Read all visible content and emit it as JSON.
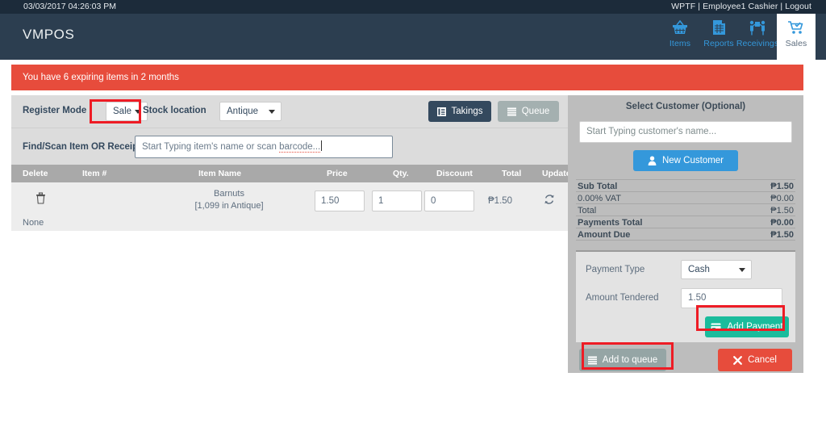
{
  "utility_bar": {
    "datetime": "03/03/2017 04:26:03 PM",
    "account": "WPTF | Employee1 Cashier | Logout"
  },
  "header": {
    "brand": "VMPOS",
    "nav": [
      {
        "label": "Items",
        "icon": "basket-icon",
        "active": false
      },
      {
        "label": "Reports",
        "icon": "report-icon",
        "active": false
      },
      {
        "label": "Receivings",
        "icon": "receivings-icon",
        "active": false
      },
      {
        "label": "Sales",
        "icon": "cart-icon",
        "active": true
      }
    ]
  },
  "alert": {
    "message": "You have 6 expiring items in 2 months",
    "color": "#e74c3c"
  },
  "control_bar": {
    "register_mode_label": "Register Mode",
    "register_mode_value": "Sale",
    "stock_location_label": "Stock location",
    "stock_location_value": "Antique",
    "takings_label": "Takings",
    "queue_label": "Queue"
  },
  "find_bar": {
    "label": "Find/Scan Item OR Receipt",
    "input_value_prefix": "Start Typing item's name or scan ",
    "input_value_misspelled": "barcode...",
    "placeholder": "Start Typing item's name or scan barcode..."
  },
  "cart_table": {
    "columns": [
      "Delete",
      "Item #",
      "Item Name",
      "Price",
      "Qty.",
      "Discount",
      "Total",
      "Update"
    ],
    "rows": [
      {
        "delete_icon": "trash-icon",
        "item_number": "",
        "item_name": "Barnuts",
        "item_stock": "[1,099 in Antique]",
        "price": "1.50",
        "qty": "1",
        "discount": "0",
        "total": "₱1.50",
        "update_icon": "refresh-icon"
      }
    ],
    "footer_note": "None"
  },
  "customer_panel": {
    "title": "Select Customer (Optional)",
    "search_value": "Start Typing customer's name...",
    "search_placeholder": "Start Typing customer's name...",
    "new_customer_label": "New Customer"
  },
  "totals": [
    {
      "label": "Sub Total",
      "value": "₱1.50",
      "bold": true
    },
    {
      "label": "0.00% VAT",
      "value": "₱0.00",
      "bold": false
    },
    {
      "label": "Total",
      "value": "₱1.50",
      "bold": false
    },
    {
      "label": "Payments Total",
      "value": "₱0.00",
      "bold": true
    },
    {
      "label": "Amount Due",
      "value": "₱1.50",
      "bold": true
    }
  ],
  "payment": {
    "type_label": "Payment Type",
    "type_value": "Cash",
    "amount_label": "Amount Tendered",
    "amount_value": "1.50",
    "add_payment_label": "Add Payment"
  },
  "actions": {
    "add_to_queue_label": "Add to queue",
    "cancel_label": "Cancel"
  },
  "annotations": {
    "highlight_color": "#ee1c25",
    "boxes": [
      "register-mode-select",
      "add-payment-button",
      "add-to-queue-button"
    ]
  }
}
